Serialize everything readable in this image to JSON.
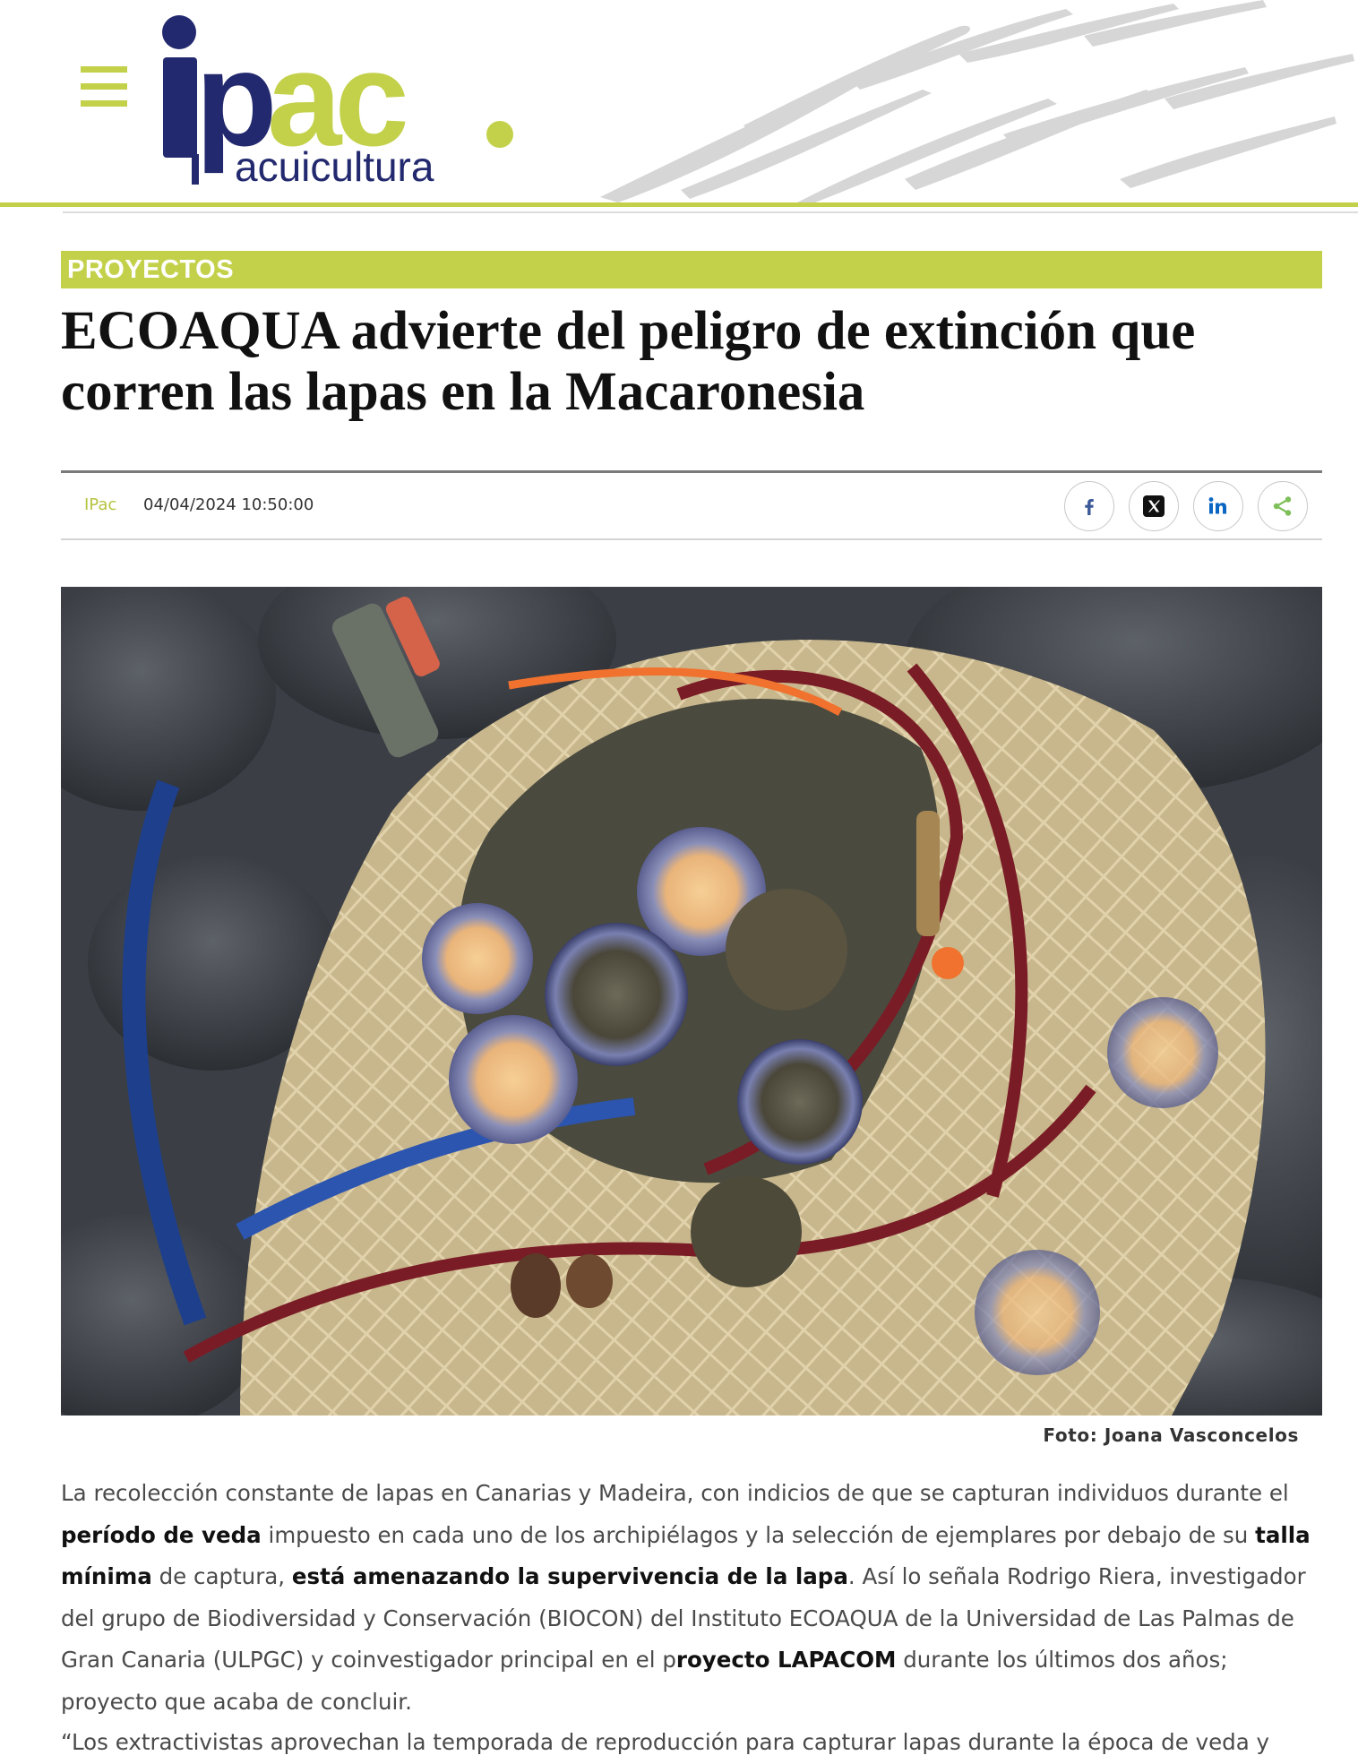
{
  "site": {
    "logo_main": "ipac.",
    "logo_sub": "acuicultura"
  },
  "article": {
    "category": "PROYECTOS",
    "title": "ECOAQUA advierte del peligro de extinción que corren las lapas en la Macaronesia",
    "author": "IPac",
    "date": "04/04/2024 10:50:00",
    "image_alt": "Lapas recolectadas dentro de una red sobre rocas",
    "caption": "Foto: Joana Vasconcelos",
    "paragraph1": {
      "t1": "La recolección constante de lapas en Canarias y Madeira, con indicios de que se capturan individuos durante el ",
      "b1": "período de veda",
      "t2": " impuesto en cada uno de los archipiélagos y la selección de ejemplares por debajo de su ",
      "b2": "talla mínima",
      "t3": " de captura, ",
      "b3": "está amenazando la supervivencia de la lapa",
      "t4": ". Así lo señala  Rodrigo Riera, investigador del grupo de Biodiversidad y Conservación (BIOCON) del Instituto ECOAQUA de la Universidad de Las Palmas de Gran Canaria (ULPGC) y coinvestigador principal en el p",
      "b4": "royecto LAPACOM",
      "t5": " durante los últimos dos años; proyecto que acaba de concluir."
    },
    "paragraph2_start": "“Los extractivistas aprovechan la temporada de reproducción para capturar lapas durante la época de veda y"
  },
  "share": {
    "icons": [
      "facebook-icon",
      "x-icon",
      "linkedin-icon",
      "share-icon"
    ]
  },
  "colors": {
    "accent": "#c3d14a",
    "brand_navy": "#23296e",
    "facebook": "#3b5998",
    "linkedin": "#0a66c2"
  }
}
